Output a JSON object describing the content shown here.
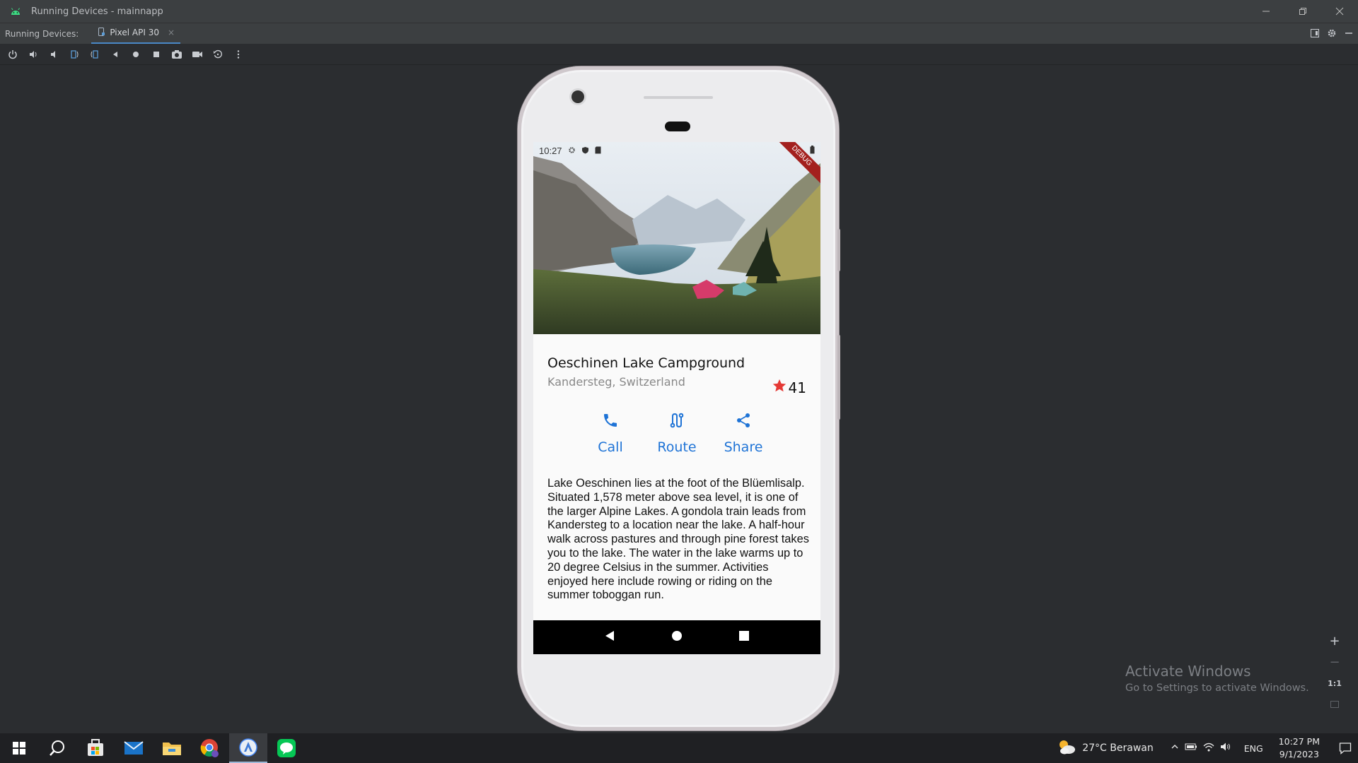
{
  "window": {
    "title": "Running Devices - mainnapp"
  },
  "tabs": {
    "label": "Running Devices:",
    "device_tab": "Pixel API 30",
    "close": "×"
  },
  "device": {
    "status_time": "10:27",
    "debug_banner": "DEBUG",
    "place": {
      "title": "Oeschinen Lake Campground",
      "location": "Kandersteg, Switzerland",
      "rating": "41"
    },
    "actions": [
      {
        "label": "Call"
      },
      {
        "label": "Route"
      },
      {
        "label": "Share"
      }
    ],
    "description": "Lake Oeschinen lies at the foot of the Blüemlisalp. Situated 1,578 meter above sea level, it is one of the larger Alpine Lakes. A gondola train leads from Kandersteg to a location near the lake. A half-hour walk across pastures and through pine forest takes you to the lake. The water in the lake warms up to 20 degree Celsius in the summer. Activities enjoyed here include rowing or riding on the summer toboggan run."
  },
  "zoom": {
    "in": "+",
    "out": "−",
    "actual": "1:1"
  },
  "watermark": {
    "line1": "Activate Windows",
    "line2": "Go to Settings to activate Windows."
  },
  "taskbar": {
    "weather": "27°C  Berawan",
    "language": "ENG",
    "time": "10:27 PM",
    "date": "9/1/2023"
  },
  "colors": {
    "accent": "#1e73d6",
    "star": "#e53935",
    "ide_bg": "#2b2d30",
    "tab_underline": "#4a88c7"
  }
}
